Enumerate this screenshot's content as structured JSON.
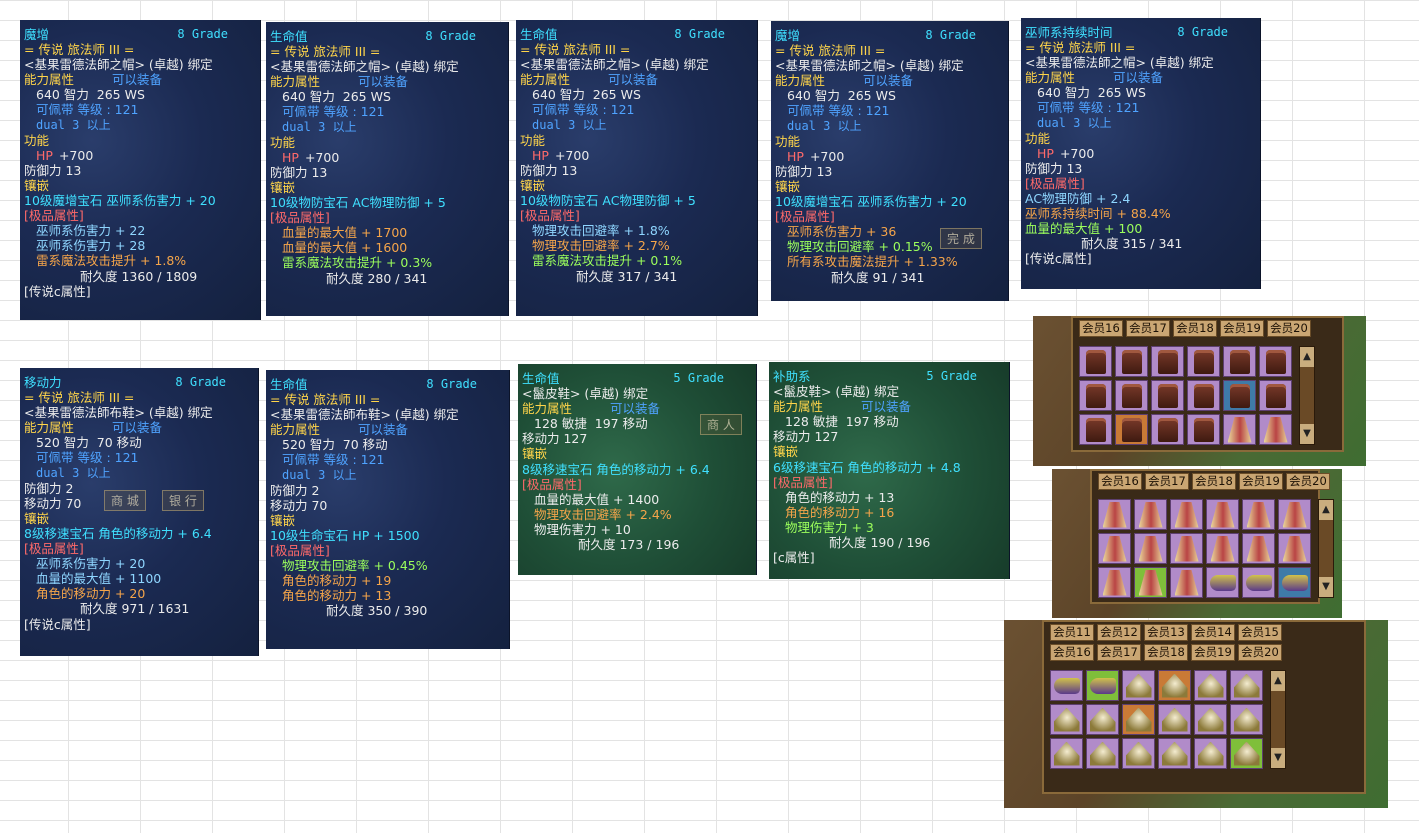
{
  "tooltips": [
    {
      "lines": [
        [
          "hdr",
          "魔增",
          "8 Grade"
        ],
        [
          "yl",
          "= 传说 旅法师 III ="
        ],
        [
          "wt",
          "<基果雷德法師之帽> (卓越) 绑定"
        ],
        [
          "pair",
          "能力属性",
          "可以装备"
        ],
        [
          "wt ind",
          "640 智力  265 WS"
        ],
        [
          "bl ind",
          "可佩带 等级 : 121"
        ],
        [
          "bl ind mono",
          "dual 3 以上"
        ],
        [
          "yl",
          "功能"
        ],
        [
          "hp",
          "HP",
          "+700"
        ],
        [
          "wt",
          "防御力 13"
        ],
        [
          "yl",
          "镶嵌"
        ],
        [
          "cy",
          "10级魔增宝石 巫师系伤害力 + 20"
        ],
        [
          "rd",
          "[极品属性]"
        ],
        [
          "lb ind",
          "巫师系伤害力 + 22"
        ],
        [
          "lb ind",
          "巫师系伤害力 + 28"
        ],
        [
          "or ind",
          "雷系魔法攻击提升 + 1.8%"
        ],
        [
          "wt ind2",
          "耐久度 1360 / 1809"
        ],
        [
          "wt",
          "[传说c属性]"
        ]
      ]
    },
    {
      "lines": [
        [
          "hdr",
          "生命值",
          "8 Grade"
        ],
        [
          "yl",
          "= 传说 旅法师 III ="
        ],
        [
          "wt",
          "<基果雷德法師之帽> (卓越) 绑定"
        ],
        [
          "pair",
          "能力属性",
          "可以装备"
        ],
        [
          "wt ind",
          "640 智力  265 WS"
        ],
        [
          "bl ind",
          "可佩带 等级 : 121"
        ],
        [
          "bl ind mono",
          "dual 3 以上"
        ],
        [
          "yl",
          "功能"
        ],
        [
          "hp",
          "HP",
          "+700"
        ],
        [
          "wt",
          "防御力 13"
        ],
        [
          "yl",
          "镶嵌"
        ],
        [
          "cy",
          "10级物防宝石 AC物理防御 + 5"
        ],
        [
          "rd",
          "[极品属性]"
        ],
        [
          "or ind",
          "血量的最大值 + 1700"
        ],
        [
          "or ind",
          "血量的最大值 + 1600"
        ],
        [
          "gr ind",
          "雷系魔法攻击提升 + 0.3%"
        ],
        [
          "wt ind2",
          "耐久度 280 / 341"
        ]
      ]
    },
    {
      "lines": [
        [
          "hdr",
          "生命值",
          "8 Grade"
        ],
        [
          "yl",
          "= 传说 旅法师 III ="
        ],
        [
          "wt",
          "<基果雷德法師之帽> (卓越) 绑定"
        ],
        [
          "pair",
          "能力属性",
          "可以装备"
        ],
        [
          "wt ind",
          "640 智力  265 WS"
        ],
        [
          "bl ind",
          "可佩带 等级 : 121"
        ],
        [
          "bl ind mono",
          "dual 3 以上"
        ],
        [
          "yl",
          "功能"
        ],
        [
          "hp",
          "HP",
          "+700"
        ],
        [
          "wt",
          "防御力 13"
        ],
        [
          "yl",
          "镶嵌"
        ],
        [
          "cy",
          "10级物防宝石 AC物理防御 + 5"
        ],
        [
          "rd",
          "[极品属性]"
        ],
        [
          "lb ind",
          "物理攻击回避率 + 1.8%"
        ],
        [
          "or ind",
          "物理攻击回避率 + 2.7%"
        ],
        [
          "gr ind",
          "雷系魔法攻击提升 + 0.1%"
        ],
        [
          "wt ind2",
          "耐久度 317 / 341"
        ]
      ]
    },
    {
      "lines": [
        [
          "hdr",
          "魔增",
          "8 Grade"
        ],
        [
          "yl",
          "= 传说 旅法师 III ="
        ],
        [
          "wt",
          "<基果雷德法師之帽> (卓越) 绑定"
        ],
        [
          "pair",
          "能力属性",
          "可以装备"
        ],
        [
          "wt ind",
          "640 智力  265 WS"
        ],
        [
          "bl ind",
          "可佩带 等级 : 121"
        ],
        [
          "bl ind mono",
          "dual 3 以上"
        ],
        [
          "yl",
          "功能"
        ],
        [
          "hp",
          "HP",
          "+700"
        ],
        [
          "wt",
          "防御力 13"
        ],
        [
          "yl",
          "镶嵌"
        ],
        [
          "cy",
          "10级魔增宝石 巫师系伤害力 + 20"
        ],
        [
          "rd",
          "[极品属性]"
        ],
        [
          "or ind",
          "巫师系伤害力 + 36"
        ],
        [
          "gr ind",
          "物理攻击回避率 + 0.15%"
        ],
        [
          "or ind",
          "所有系攻击魔法提升 + 1.33%"
        ],
        [
          "wt ind2",
          "耐久度 91 / 341"
        ]
      ]
    },
    {
      "lines": [
        [
          "hdr",
          "巫师系持续时间",
          "8 Grade"
        ],
        [
          "yl",
          "= 传说 旅法师 III ="
        ],
        [
          "wt",
          "<基果雷德法師之帽> (卓越) 绑定"
        ],
        [
          "pair",
          "能力属性",
          "可以装备"
        ],
        [
          "wt ind",
          "640 智力  265 WS"
        ],
        [
          "bl ind",
          "可佩带 等级 : 121"
        ],
        [
          "bl ind mono",
          "dual 3 以上"
        ],
        [
          "yl",
          "功能"
        ],
        [
          "hp",
          "HP",
          "+700"
        ],
        [
          "wt",
          "防御力 13"
        ],
        [
          "rd",
          "[极品属性]"
        ],
        [
          "lb",
          "AC物理防御 + 2.4"
        ],
        [
          "or",
          "巫师系持续时间 + 88.4%"
        ],
        [
          "gr",
          "血量的最大值 + 100"
        ],
        [
          "wt ind2",
          "耐久度 315 / 341"
        ],
        [
          "wt",
          "[传说c属性]"
        ]
      ]
    },
    {
      "lines": [
        [
          "hdr",
          "移动力",
          "8 Grade"
        ],
        [
          "yl",
          "= 传说 旅法师 III ="
        ],
        [
          "wt",
          "<基果雷德法師布鞋> (卓越) 绑定"
        ],
        [
          "pair",
          "能力属性",
          "可以装备"
        ],
        [
          "wt ind",
          "520 智力  70 移动"
        ],
        [
          "bl ind",
          "可佩带 等级 : 121"
        ],
        [
          "bl ind mono",
          "dual 3 以上"
        ],
        [
          "wt",
          "防御力 2"
        ],
        [
          "wt",
          "移动力 70"
        ],
        [
          "yl",
          "镶嵌"
        ],
        [
          "cy",
          "8级移速宝石 角色的移动力 + 6.4"
        ],
        [
          "rd",
          "[极品属性]"
        ],
        [
          "lb ind",
          "巫师系伤害力 + 20"
        ],
        [
          "lb ind",
          "血量的最大值 + 1100"
        ],
        [
          "or ind",
          "角色的移动力 + 20"
        ],
        [
          "wt ind2",
          "耐久度 971 / 1631"
        ],
        [
          "wt",
          "[传说c属性]"
        ]
      ]
    },
    {
      "lines": [
        [
          "hdr",
          "生命值",
          "8 Grade"
        ],
        [
          "yl",
          "= 传说 旅法师 III ="
        ],
        [
          "wt",
          "<基果雷德法師布鞋> (卓越) 绑定"
        ],
        [
          "pair",
          "能力属性",
          "可以装备"
        ],
        [
          "wt ind",
          "520 智力  70 移动"
        ],
        [
          "bl ind",
          "可佩带 等级 : 121"
        ],
        [
          "bl ind mono",
          "dual 3 以上"
        ],
        [
          "wt",
          "防御力 2"
        ],
        [
          "wt",
          "移动力 70"
        ],
        [
          "yl",
          "镶嵌"
        ],
        [
          "cy",
          "10级生命宝石 HP + 1500"
        ],
        [
          "rd",
          "[极品属性]"
        ],
        [
          "gr ind",
          "物理攻击回避率 + 0.45%"
        ],
        [
          "or ind",
          "角色的移动力 + 19"
        ],
        [
          "or ind",
          "角色的移动力 + 13"
        ],
        [
          "wt ind2",
          "耐久度 350 / 390"
        ]
      ]
    },
    {
      "lines": [
        [
          "hdr",
          "生命值",
          "5 Grade"
        ],
        [
          "wt",
          "<鬣皮鞋> (卓越) 绑定"
        ],
        [
          "pair",
          "能力属性",
          "可以装备"
        ],
        [
          "wt ind",
          "128 敏捷  197 移动"
        ],
        [
          "wt",
          "移动力 127"
        ],
        [
          "yl",
          "镶嵌"
        ],
        [
          "cy",
          "8级移速宝石 角色的移动力 + 6.4"
        ],
        [
          "rd",
          "[极品属性]"
        ],
        [
          "wt ind",
          "血量的最大值 + 1400"
        ],
        [
          "or ind",
          "物理攻击回避率 + 2.4%"
        ],
        [
          "wt ind",
          "物理伤害力 + 10"
        ],
        [
          "wt ind2",
          "耐久度 173 / 196"
        ]
      ]
    },
    {
      "lines": [
        [
          "hdr",
          "补助系",
          "5 Grade"
        ],
        [
          "wt",
          "<鬣皮鞋> (卓越) 绑定"
        ],
        [
          "pair",
          "能力属性",
          "可以装备"
        ],
        [
          "wt ind",
          "128 敏捷  197 移动"
        ],
        [
          "wt",
          "移动力 127"
        ],
        [
          "yl",
          "镶嵌"
        ],
        [
          "cy",
          "6级移速宝石 角色的移动力 + 4.8"
        ],
        [
          "rd",
          "[极品属性]"
        ],
        [
          "wt ind",
          "角色的移动力 + 13"
        ],
        [
          "or ind",
          "角色的移动力 + 16"
        ],
        [
          "gr ind",
          "物理伤害力 + 3"
        ],
        [
          "wt ind2",
          "耐久度 190 / 196"
        ],
        [
          "wt",
          "[c属性]"
        ]
      ]
    }
  ],
  "ghost_buttons": {
    "shop": "商 城",
    "bank": "银 行",
    "merchant": "商 人",
    "done": "完 成"
  },
  "inventories": [
    {
      "tab_rows": [
        [
          "会员16",
          "会员17",
          "会员18",
          "会员19",
          "会员20"
        ]
      ],
      "items": [
        [
          "boot",
          "boot",
          "boot",
          "boot",
          "boot"
        ],
        [
          "boot",
          "boot",
          "boot",
          "boot",
          "boot:sel-blue",
          "boot"
        ],
        [
          "boot",
          "boot:sel-orange",
          "boot",
          "boot",
          "robe",
          "robe"
        ]
      ]
    },
    {
      "tab_rows": [
        [
          "会员16",
          "会员17",
          "会员18",
          "会员19",
          "会员20"
        ]
      ],
      "items": [
        [
          "robe",
          "robe",
          "robe",
          "robe",
          "robe",
          "robe"
        ],
        [
          "robe",
          "robe",
          "robe",
          "robe",
          "robe",
          "robe"
        ],
        [
          "robe",
          "robe:sel-green",
          "robe",
          "shoe",
          "shoe",
          "shoe:sel-blue",
          "shoe"
        ]
      ]
    },
    {
      "tab_rows": [
        [
          "会员11",
          "会员12",
          "会员13",
          "会员14",
          "会员15"
        ],
        [
          "会员16",
          "会员17",
          "会员18",
          "会员19",
          "会员20"
        ]
      ],
      "items": [
        [
          "shoe",
          "shoe:sel-green",
          "hat",
          "hat:sel-orange",
          "hat",
          "hat"
        ],
        [
          "hat",
          "hat",
          "hat:sel-orange",
          "hat",
          "hat",
          "hat"
        ],
        [
          "hat",
          "hat",
          "hat",
          "hat",
          "hat",
          "hat:sel-green"
        ]
      ]
    }
  ],
  "colors": {
    "tooltip_bg": "#1b2a52",
    "tooltip_green_bg": "#1f4f37",
    "accent_cyan": "#3fe0ff",
    "gold": "#ffd54a",
    "excellent_red": "#ff6a6a"
  }
}
